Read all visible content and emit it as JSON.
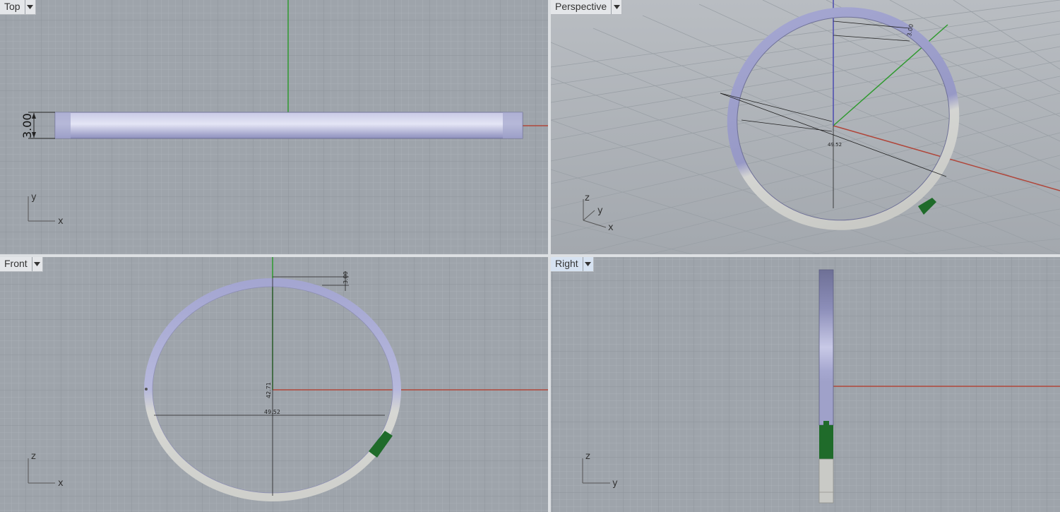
{
  "viewports": {
    "top": {
      "label": "Top",
      "dim_height": "3.00",
      "axis_a": "y",
      "axis_b": "x"
    },
    "perspective": {
      "label": "Perspective",
      "dim_a": "3.00",
      "dim_b": "49.52",
      "axis_z": "z",
      "axis_y": "y",
      "axis_x": "x"
    },
    "front": {
      "label": "Front",
      "dim_top": "3.00",
      "dim_v": "42.71",
      "dim_h": "49.52",
      "axis_a": "z",
      "axis_b": "x"
    },
    "right": {
      "label": "Right",
      "axis_a": "z",
      "axis_b": "y",
      "active": true
    }
  },
  "colors": {
    "viewport_bg": "#9ea4ab",
    "grid_minor": "#a9afb5",
    "grid_major": "#8f969d",
    "x_axis": "#b0463a",
    "y_axis": "#2f9a2f",
    "z_axis": "#4a4ab0",
    "ring_purple": "#a6a8d2",
    "ring_silver": "#d2d3d0",
    "clasp_green": "#1f6b2a"
  }
}
